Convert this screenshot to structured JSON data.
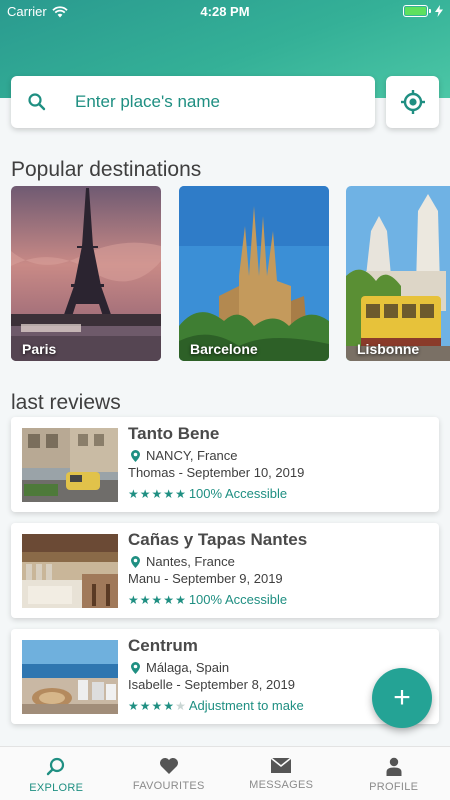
{
  "status_bar": {
    "carrier": "Carrier",
    "time": "4:28 PM",
    "wifi_icon": "wifi-icon",
    "battery_icon": "battery-icon"
  },
  "search": {
    "placeholder": "Enter place's name",
    "icon": "search-icon",
    "locate_icon": "crosshair-icon"
  },
  "popular": {
    "title": "Popular destinations",
    "items": [
      {
        "label": "Paris"
      },
      {
        "label": "Barcelone"
      },
      {
        "label": "Lisbonne"
      }
    ]
  },
  "reviews": {
    "title": "last reviews",
    "items": [
      {
        "name": "Tanto Bene",
        "location": "NANCY, France",
        "author_date": "Thomas - September 10, 2019",
        "stars": 5,
        "rating_label": "100% Accessible"
      },
      {
        "name": "Cañas y Tapas Nantes",
        "location": "Nantes, France",
        "author_date": "Manu - September 9, 2019",
        "stars": 5,
        "rating_label": "100% Accessible"
      },
      {
        "name": "Centrum",
        "location": "Málaga, Spain",
        "author_date": "Isabelle - September 8, 2019",
        "stars": 4,
        "rating_label": "Adjustment to make"
      }
    ]
  },
  "fab": {
    "label": "+"
  },
  "tabs": [
    {
      "label": "EXPLORE",
      "icon": "compass-icon",
      "active": true
    },
    {
      "label": "FAVOURITES",
      "icon": "heart-icon",
      "active": false
    },
    {
      "label": "MESSAGES",
      "icon": "envelope-icon",
      "active": false
    },
    {
      "label": "PROFILE",
      "icon": "person-icon",
      "active": false
    }
  ],
  "colors": {
    "accent": "#1f8f82",
    "header_start": "#2a9a8f",
    "header_end": "#4cc7a6",
    "fab": "#24a395"
  }
}
